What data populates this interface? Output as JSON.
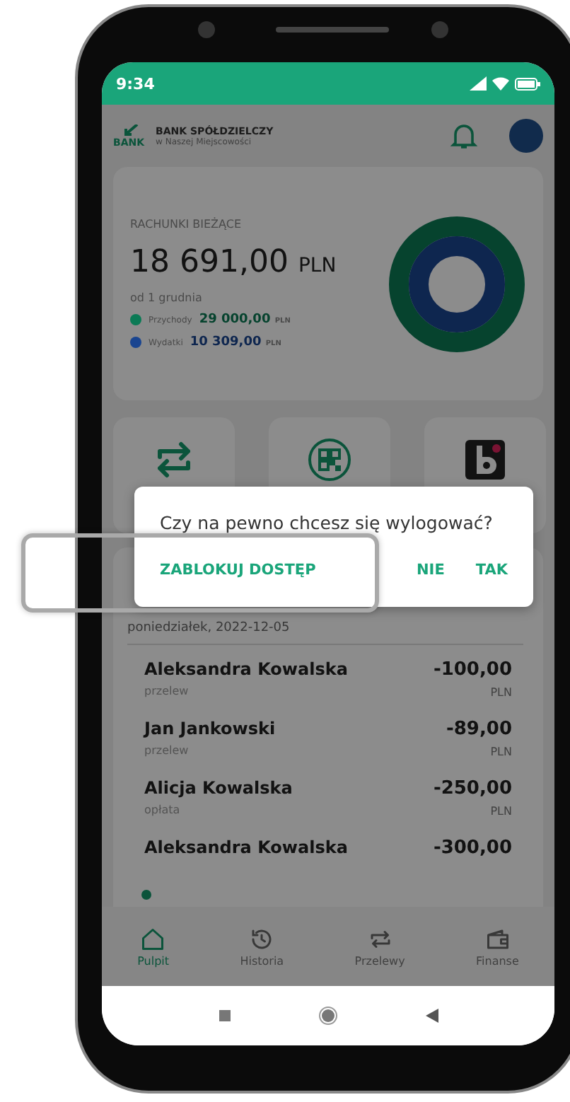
{
  "status_bar": {
    "time": "9:34"
  },
  "header": {
    "logo_text": "BANK",
    "bank_name": "BANK SPÓŁDZIELCZY",
    "bank_subtitle": "w Naszej Miejscowości"
  },
  "balance_card": {
    "title": "RACHUNKI BIEŻĄCE",
    "amount": "18 691,00",
    "currency": "PLN",
    "period": "od 1 grudnia",
    "legend": [
      {
        "label": "Przychody",
        "amount": "29 000,00",
        "currency": "PLN",
        "color": "#0b7a55"
      },
      {
        "label": "Wydatki",
        "amount": "10 309,00",
        "currency": "PLN",
        "color": "#1a4590"
      }
    ]
  },
  "shortcuts": [
    {
      "kind": "transfer"
    },
    {
      "kind": "qr"
    },
    {
      "kind": "blik"
    }
  ],
  "transactions": {
    "date": "poniedziałek, 2022-12-05",
    "rows": [
      {
        "name": "Aleksandra Kowalska",
        "type": "przelew",
        "amount": "-100,00",
        "currency": "PLN"
      },
      {
        "name": "Jan Jankowski",
        "type": "przelew",
        "amount": "-89,00",
        "currency": "PLN"
      },
      {
        "name": "Alicja Kowalska",
        "type": "opłata",
        "amount": "-250,00",
        "currency": "PLN"
      },
      {
        "name": "Aleksandra Kowalska",
        "amount": "-300,00"
      }
    ]
  },
  "dialog": {
    "message": "Czy na pewno chcesz się wylogować?",
    "buttons": [
      {
        "label": "ZABLOKUJ DOSTĘP"
      },
      {
        "label": "NIE"
      },
      {
        "label": "TAK"
      }
    ]
  },
  "bottom_nav": [
    {
      "label": "Pulpit",
      "kind": "home",
      "selected": true
    },
    {
      "label": "Historia",
      "kind": "history",
      "selected": false
    },
    {
      "label": "Przelewy",
      "kind": "transfer",
      "selected": false
    },
    {
      "label": "Finanse",
      "kind": "wallet",
      "selected": false
    }
  ]
}
